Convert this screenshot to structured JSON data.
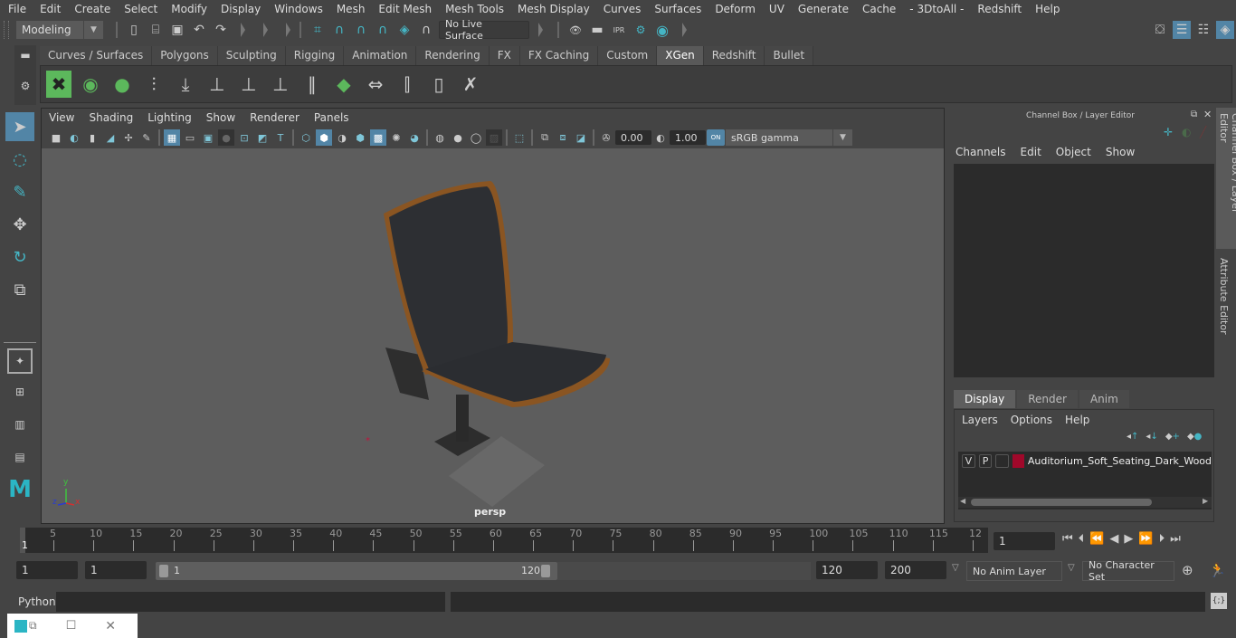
{
  "menubar": {
    "items": [
      "File",
      "Edit",
      "Create",
      "Select",
      "Modify",
      "Display",
      "Windows",
      "Mesh",
      "Edit Mesh",
      "Mesh Tools",
      "Mesh Display",
      "Curves",
      "Surfaces",
      "Deform",
      "UV",
      "Generate",
      "Cache",
      "- 3DtoAll -",
      "Redshift",
      "Help"
    ]
  },
  "statusline": {
    "mode": "Modeling",
    "live_surface": "No Live Surface",
    "icons": [
      "new-scene-icon",
      "open-scene-icon",
      "save-scene-icon",
      "undo-icon",
      "redo-icon",
      "snap-grid-icon",
      "snap-curve-icon",
      "snap-point-icon",
      "snap-view-plane-icon",
      "snap-live-icon",
      "make-live-icon",
      "render-view-icon",
      "render-current-icon",
      "ipr-render-icon",
      "render-settings-icon",
      "hypershade-icon"
    ],
    "right_icons": [
      "modeling-toolkit-icon",
      "attribute-editor-toggle-icon",
      "tool-settings-icon",
      "channel-box-toggle-icon"
    ]
  },
  "shelf": {
    "tabs": [
      "Curves / Surfaces",
      "Polygons",
      "Sculpting",
      "Rigging",
      "Animation",
      "Rendering",
      "FX",
      "FX Caching",
      "Custom",
      "XGen",
      "Redshift",
      "Bullet"
    ],
    "active_tab": "XGen",
    "icons": [
      "xgen-editor-icon",
      "xgen-preview-icon",
      "xgen-clear-preview-icon",
      "xgen-add-guides-icon",
      "xgen-place-guides-icon",
      "xgen-add-guide-icon",
      "xgen-show-guides-icon",
      "xgen-lock-guides-icon",
      "xgen-sculpt-guides-icon",
      "xgen-patch-icon",
      "xgen-flip-guides-icon",
      "xgen-select-guides-icon",
      "xgen-guides-to-curves-icon",
      "xgen-delete-guides-icon"
    ]
  },
  "toolbox": {
    "tools": [
      "select-tool",
      "lasso-tool",
      "paint-select-tool",
      "move-tool",
      "rotate-tool",
      "scale-tool"
    ],
    "layouts": [
      "single-perspective-layout",
      "four-view-layout",
      "outliner-persp-layout",
      "persp-graph-layout"
    ]
  },
  "viewport": {
    "menu": [
      "View",
      "Shading",
      "Lighting",
      "Show",
      "Renderer",
      "Panels"
    ],
    "exposure": "0.00",
    "gamma": "1.00",
    "color_space": "sRGB gamma",
    "color_mgmt": "ON",
    "camera_label": "persp",
    "axis": {
      "x": "x",
      "y": "y",
      "z": "z"
    }
  },
  "channel_box": {
    "title": "Channel Box / Layer Editor",
    "menu": [
      "Channels",
      "Edit",
      "Object",
      "Show"
    ]
  },
  "layer_editor": {
    "tabs": [
      "Display",
      "Render",
      "Anim"
    ],
    "active_tab": "Display",
    "menu": [
      "Layers",
      "Options",
      "Help"
    ],
    "layers": [
      {
        "v": "V",
        "p": "P",
        "color": "#a0082a",
        "name": "Auditorium_Soft_Seating_Dark_Wood"
      }
    ]
  },
  "side_tabs": [
    "Channel Box / Layer Editor",
    "Attribute Editor"
  ],
  "timeline": {
    "ticks": [
      "5",
      "10",
      "15",
      "20",
      "25",
      "30",
      "35",
      "40",
      "45",
      "50",
      "55",
      "60",
      "65",
      "70",
      "75",
      "80",
      "85",
      "90",
      "95",
      "100",
      "105",
      "110",
      "115",
      "12"
    ],
    "current_frame_label": "1",
    "current_frame": "1"
  },
  "range": {
    "start": "1",
    "playback_start": "1",
    "slider_start": "1",
    "slider_end": "120",
    "playback_end": "120",
    "end": "200",
    "anim_layer": "No Anim Layer",
    "character_set": "No Character Set"
  },
  "cmdline": {
    "label": "Python"
  },
  "colors": {
    "accent": "#5285a6",
    "layer_color": "#a0082a",
    "shelf_green": "#5cb85c",
    "teal": "#45b5c4"
  }
}
